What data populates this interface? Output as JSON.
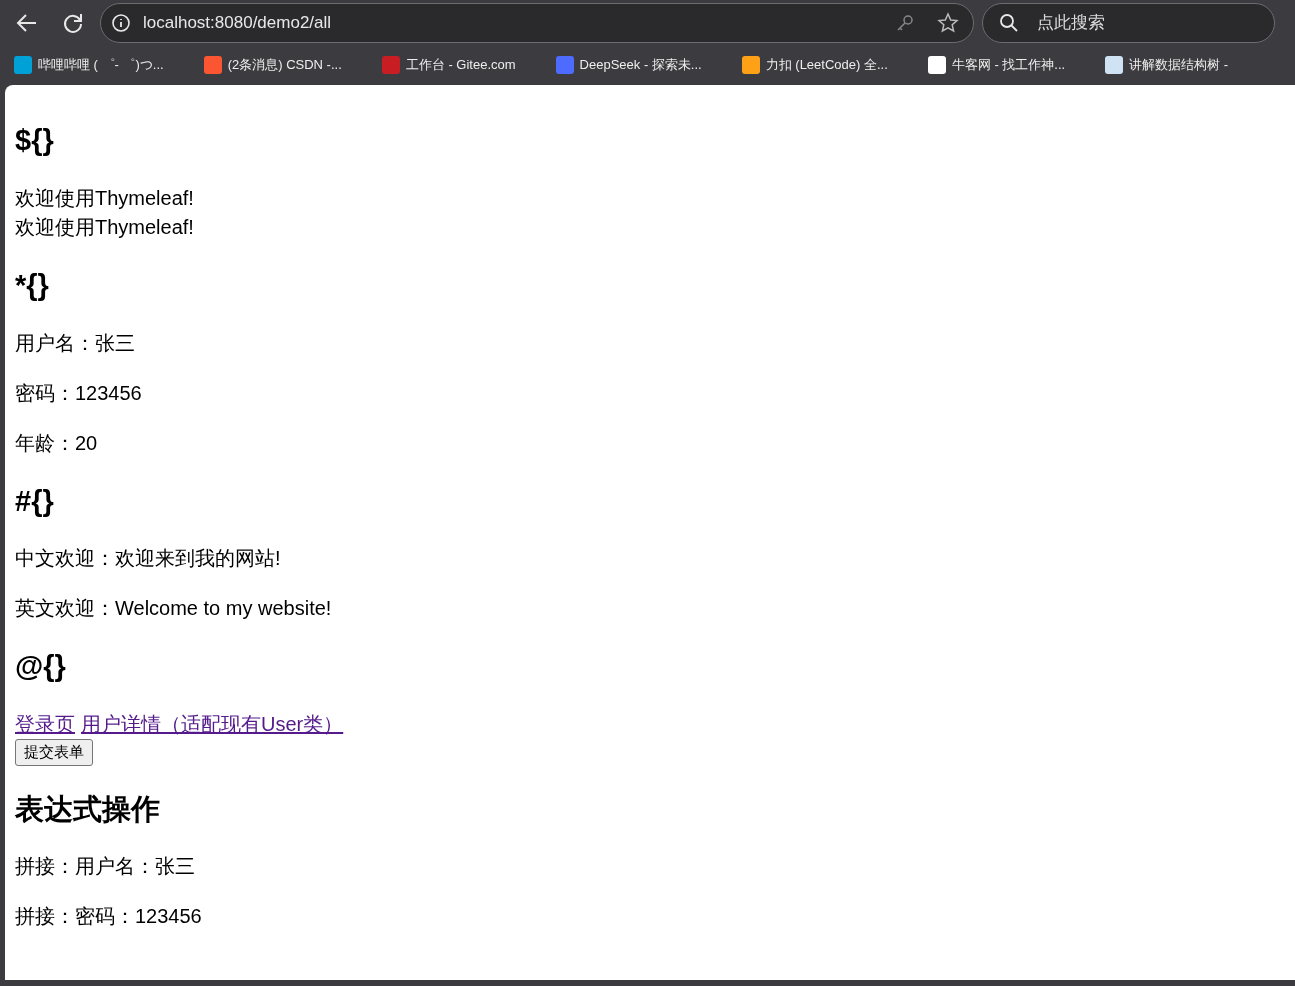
{
  "browser": {
    "url": "localhost:8080/demo2/all",
    "search_placeholder": "点此搜索",
    "bookmarks": [
      {
        "title": "哔哩哔哩 ( ゜- ゜)つ...",
        "color": "#00a1d6"
      },
      {
        "title": "(2条消息) CSDN -...",
        "color": "#fc5531"
      },
      {
        "title": "工作台 - Gitee.com",
        "color": "#c71d23"
      },
      {
        "title": "DeepSeek - 探索未...",
        "color": "#4d6bfe"
      },
      {
        "title": "力扣 (LeetCode) 全...",
        "color": "#ffa116"
      },
      {
        "title": "牛客网 - 找工作神...",
        "color": "#ffffff"
      },
      {
        "title": "讲解数据结构树 -",
        "color": "#cfe3f5"
      }
    ]
  },
  "page": {
    "sections": [
      {
        "heading": "${}",
        "items": [
          {
            "kind": "line",
            "text": "欢迎使用Thymeleaf!"
          },
          {
            "kind": "line",
            "text": "欢迎使用Thymeleaf!"
          }
        ]
      },
      {
        "heading": "*{}",
        "items": [
          {
            "kind": "para",
            "text": "用户名：张三"
          },
          {
            "kind": "para",
            "text": "密码：123456"
          },
          {
            "kind": "para",
            "text": "年龄：20"
          }
        ]
      },
      {
        "heading": "#{}",
        "items": [
          {
            "kind": "para",
            "text": "中文欢迎：欢迎来到我的网站!"
          },
          {
            "kind": "para",
            "text": "英文欢迎：Welcome to my website!"
          }
        ]
      },
      {
        "heading": "@{}",
        "items": [
          {
            "kind": "links",
            "links": [
              "登录页",
              "用户详情（适配现有User类）"
            ]
          },
          {
            "kind": "button",
            "text": "提交表单"
          }
        ]
      },
      {
        "heading": "表达式操作",
        "items": [
          {
            "kind": "para",
            "text": "拼接：用户名：张三"
          },
          {
            "kind": "para",
            "text": "拼接：密码：123456"
          }
        ]
      }
    ]
  }
}
